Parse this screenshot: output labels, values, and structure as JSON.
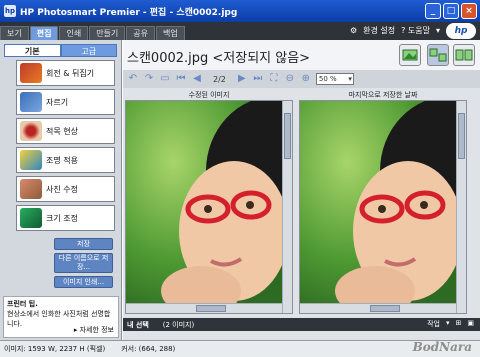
{
  "window": {
    "title": "HP Photosmart Premier - 편집 - 스캔0002.jpg"
  },
  "menu_tabs": [
    "보기",
    "편집",
    "인쇄",
    "만들기",
    "공유",
    "백업"
  ],
  "menu_right": {
    "settings": "환경 설정",
    "help": "? 도움말"
  },
  "left": {
    "subtabs": [
      "기본",
      "고급"
    ],
    "tools": [
      "회전 & 뒤집기",
      "자르기",
      "적목 현상",
      "조명 적용",
      "사진 수정",
      "크기 조정"
    ],
    "actions": [
      "저장",
      "다른 이름으로 저장...",
      "이미지 인쇄..."
    ],
    "tip": {
      "heading": "프린터 팁.",
      "body": "현상소에서 인화한 사진처럼 선명합니다.",
      "more": "▸ 자세한 정보"
    }
  },
  "main": {
    "filename": "스캔0002.jpg <저장되지 않음>",
    "page_counter": "2/2",
    "zoom": "50 %",
    "pane_left": "수정된 이미지",
    "pane_right": "마지막으로 저장한 날짜",
    "tray_label": "내 선택",
    "tray_count": "(2 이미지)",
    "tray_action": "작업"
  },
  "status": {
    "image": "이미지: 1593 W, 2237 H (픽셀)",
    "cursor": "커서: (664, 288)"
  },
  "watermark": "BodNara"
}
